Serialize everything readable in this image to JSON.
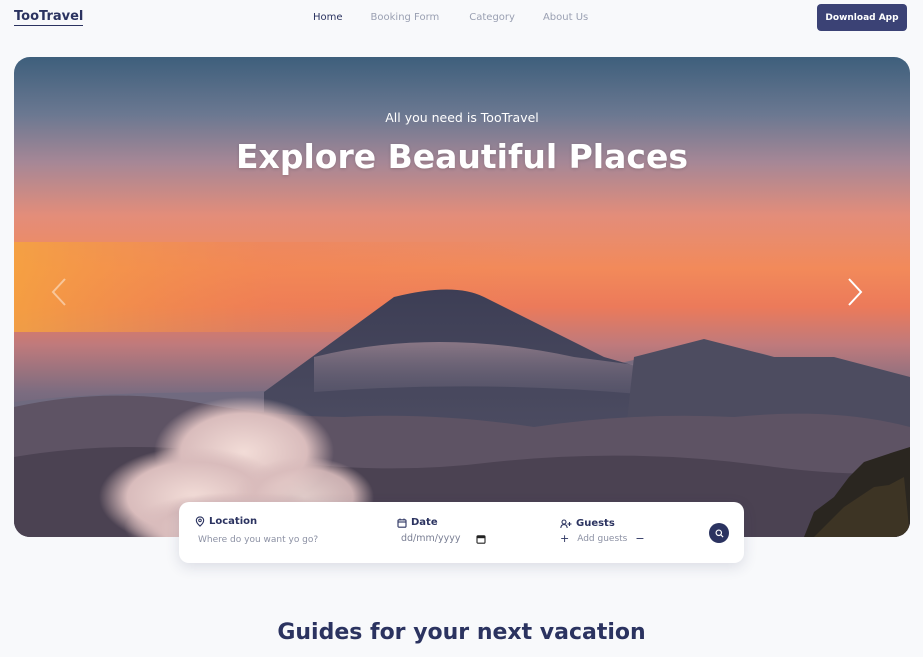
{
  "navbar": {
    "logo": "TooTravel",
    "links": [
      {
        "label": "Home",
        "active": true
      },
      {
        "label": "Booking Form",
        "active": false
      },
      {
        "label": "Category",
        "active": false
      },
      {
        "label": "About Us",
        "active": false
      }
    ],
    "download_label": "Download App"
  },
  "hero": {
    "subtitle": "All you need is TooTravel",
    "title": "Explore Beautiful Places",
    "prev_icon": "chevron-left-icon",
    "next_icon": "chevron-right-icon"
  },
  "search": {
    "location_label": "Location",
    "location_placeholder": "Where do you want yo go?",
    "date_label": "Date",
    "date_placeholder": "dd/mm/yyyy",
    "guests_label": "Guests",
    "guests_placeholder": "Add guests",
    "plus": "+",
    "minus": "−"
  },
  "section": {
    "heading": "Guides for your next vacation"
  },
  "colors": {
    "brand": "#2b3360",
    "button": "#3b4275",
    "background": "#f8f9fb"
  }
}
